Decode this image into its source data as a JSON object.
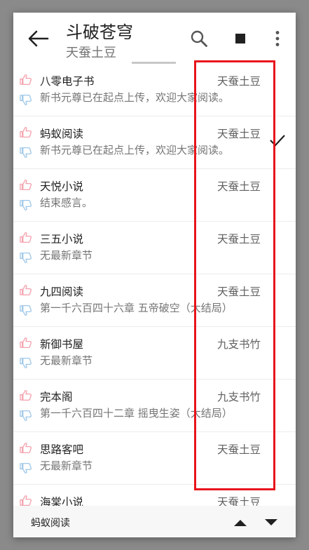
{
  "header": {
    "title": "斗破苍穹",
    "subtitle": "天蚕土豆"
  },
  "sources": [
    {
      "name": "八零电子书",
      "origin": "天蚕土豆",
      "chapter": "新书元尊已在起点上传，欢迎大家阅读。",
      "selected": false
    },
    {
      "name": "蚂蚁阅读",
      "origin": "天蚕土豆",
      "chapter": "新书元尊已在起点上传，欢迎大家阅读。",
      "selected": true
    },
    {
      "name": "天悦小说",
      "origin": "天蚕土豆",
      "chapter": "结束感言。",
      "selected": false
    },
    {
      "name": "三五小说",
      "origin": "天蚕土豆",
      "chapter": "无最新章节",
      "selected": false
    },
    {
      "name": "九四阅读",
      "origin": "天蚕土豆",
      "chapter": "第一千六百四十六章 五帝破空（大结局）",
      "selected": false
    },
    {
      "name": "新御书屋",
      "origin": "九支书竹",
      "chapter": "无最新章节",
      "selected": false
    },
    {
      "name": "完本阁",
      "origin": "九支书竹",
      "chapter": "第一千六百四十二章 摇曳生姿（大结局）",
      "selected": false
    },
    {
      "name": "思路客吧",
      "origin": "天蚕土豆",
      "chapter": "无最新章节",
      "selected": false
    },
    {
      "name": "海棠小说",
      "origin": "天蚕土豆",
      "chapter": "",
      "selected": false
    }
  ],
  "footer": {
    "current_source": "蚂蚁阅读"
  },
  "colors": {
    "thumb_up": "#f4a1ac",
    "thumb_down": "#9ec7e8",
    "highlight": "#e8141c"
  }
}
